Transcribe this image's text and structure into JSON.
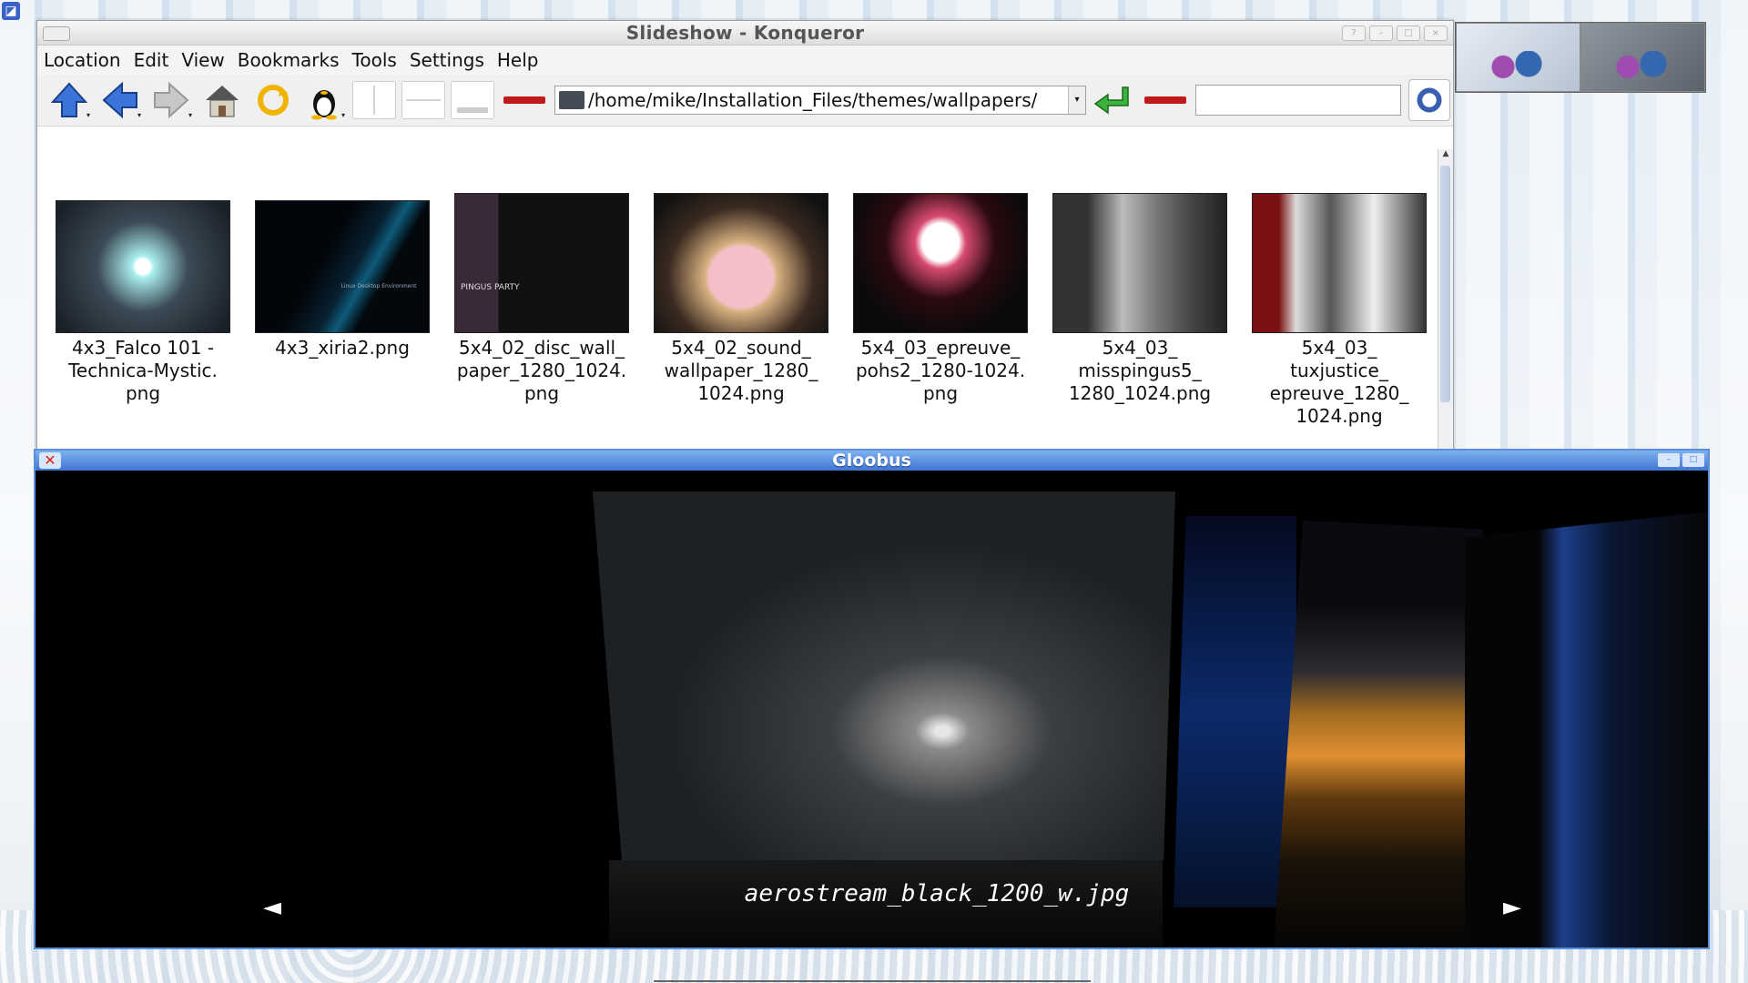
{
  "konqueror": {
    "title": "Slideshow - Konqueror",
    "menu": [
      "Location",
      "Edit",
      "View",
      "Bookmarks",
      "Tools",
      "Settings",
      "Help"
    ],
    "url": "/home/mike/Installation_Files/themes/wallpapers/",
    "search": "",
    "files": [
      "4x3_Falco 101 -\nTechnica-Mystic.\npng",
      "4x3_xiria2.png",
      "5x4_02_disc_wall_\npaper_1280_1024.\npng",
      "5x4_02_sound_\nwallpaper_1280_\n1024.png",
      "5x4_03_epreuve_\npohs2_1280-1024.\npng",
      "5x4_03_\nmisspingus5_\n1280_1024.png",
      "5x4_03_\ntuxjustice_\nepreuve_1280_\n1024.png"
    ],
    "thumb_text": [
      "",
      "Linux Desktop Environment",
      "PINGUS PARTY",
      "",
      "",
      "",
      ""
    ]
  },
  "gloobus": {
    "title": "Gloobus",
    "caption": "aerostream_black_1200_w.jpg",
    "prev": "◄",
    "next": "►"
  },
  "icons": [
    "arrow-up-icon",
    "arrow-left-icon",
    "arrow-right-icon",
    "home-icon",
    "reload-icon",
    "tux-icon",
    "split-view-icon",
    "split-horizontal-icon",
    "terminal-panel-icon",
    "url-go-icon",
    "konqueror-throbber-icon"
  ]
}
